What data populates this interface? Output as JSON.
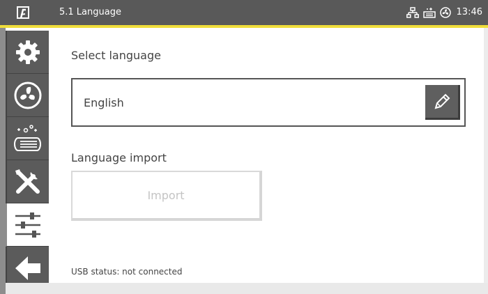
{
  "header": {
    "title": "5.1 Language",
    "time": "13:46",
    "logo_icon": "brand-logo-icon",
    "status_icons": [
      "network-icon",
      "usb-device-icon",
      "fan-status-icon"
    ]
  },
  "sidebar": {
    "items": [
      {
        "icon": "gear-icon",
        "active": false
      },
      {
        "icon": "fan-icon",
        "active": false
      },
      {
        "icon": "filter-icon",
        "active": false
      },
      {
        "icon": "tools-icon",
        "active": false
      },
      {
        "icon": "sliders-icon",
        "active": true
      },
      {
        "icon": "back-arrow-icon",
        "active": false
      }
    ]
  },
  "main": {
    "select_language_label": "Select language",
    "language_value": "English",
    "edit_icon": "pencil-icon",
    "language_import_label": "Language import",
    "import_button_label": "Import",
    "import_enabled": false,
    "usb_status": "USB status: not connected"
  },
  "colors": {
    "topbar": "#595959",
    "accent": "#efdd3a",
    "sidebar_button": "#5b5b5b",
    "border": "#555555"
  }
}
